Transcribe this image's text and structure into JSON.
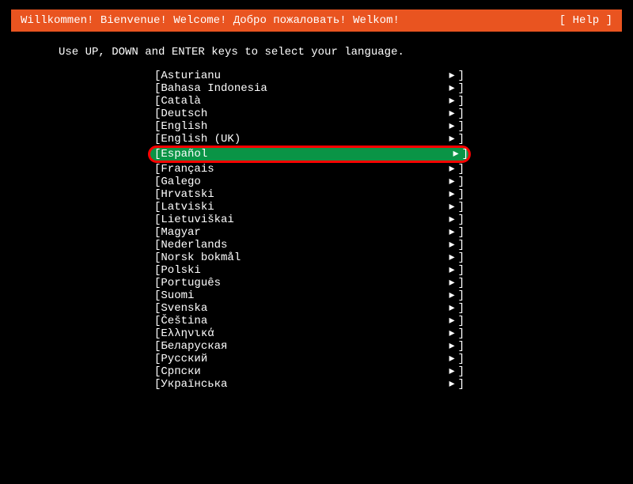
{
  "header": {
    "title": "Willkommen! Bienvenue! Welcome! Добро пожаловать! Welkom!",
    "help": "[ Help ]"
  },
  "instruction": "Use UP, DOWN and ENTER keys to select your language.",
  "bracket_left": "[ ",
  "arrow": "▸ ",
  "bracket_right": "]",
  "languages": [
    {
      "name": "Asturianu",
      "selected": false,
      "highlighted": false
    },
    {
      "name": "Bahasa Indonesia",
      "selected": false,
      "highlighted": false
    },
    {
      "name": "Català",
      "selected": false,
      "highlighted": false
    },
    {
      "name": "Deutsch",
      "selected": false,
      "highlighted": false
    },
    {
      "name": "English",
      "selected": false,
      "highlighted": false
    },
    {
      "name": "English (UK)",
      "selected": false,
      "highlighted": false
    },
    {
      "name": "Español",
      "selected": true,
      "highlighted": true
    },
    {
      "name": "Français",
      "selected": false,
      "highlighted": false
    },
    {
      "name": "Galego",
      "selected": false,
      "highlighted": false
    },
    {
      "name": "Hrvatski",
      "selected": false,
      "highlighted": false
    },
    {
      "name": "Latviski",
      "selected": false,
      "highlighted": false
    },
    {
      "name": "Lietuviškai",
      "selected": false,
      "highlighted": false
    },
    {
      "name": "Magyar",
      "selected": false,
      "highlighted": false
    },
    {
      "name": "Nederlands",
      "selected": false,
      "highlighted": false
    },
    {
      "name": "Norsk bokmål",
      "selected": false,
      "highlighted": false
    },
    {
      "name": "Polski",
      "selected": false,
      "highlighted": false
    },
    {
      "name": "Português",
      "selected": false,
      "highlighted": false
    },
    {
      "name": "Suomi",
      "selected": false,
      "highlighted": false
    },
    {
      "name": "Svenska",
      "selected": false,
      "highlighted": false
    },
    {
      "name": "Čeština",
      "selected": false,
      "highlighted": false
    },
    {
      "name": "Ελληνικά",
      "selected": false,
      "highlighted": false
    },
    {
      "name": "Беларуская",
      "selected": false,
      "highlighted": false
    },
    {
      "name": "Русский",
      "selected": false,
      "highlighted": false
    },
    {
      "name": "Српски",
      "selected": false,
      "highlighted": false
    },
    {
      "name": "Українська",
      "selected": false,
      "highlighted": false
    }
  ]
}
